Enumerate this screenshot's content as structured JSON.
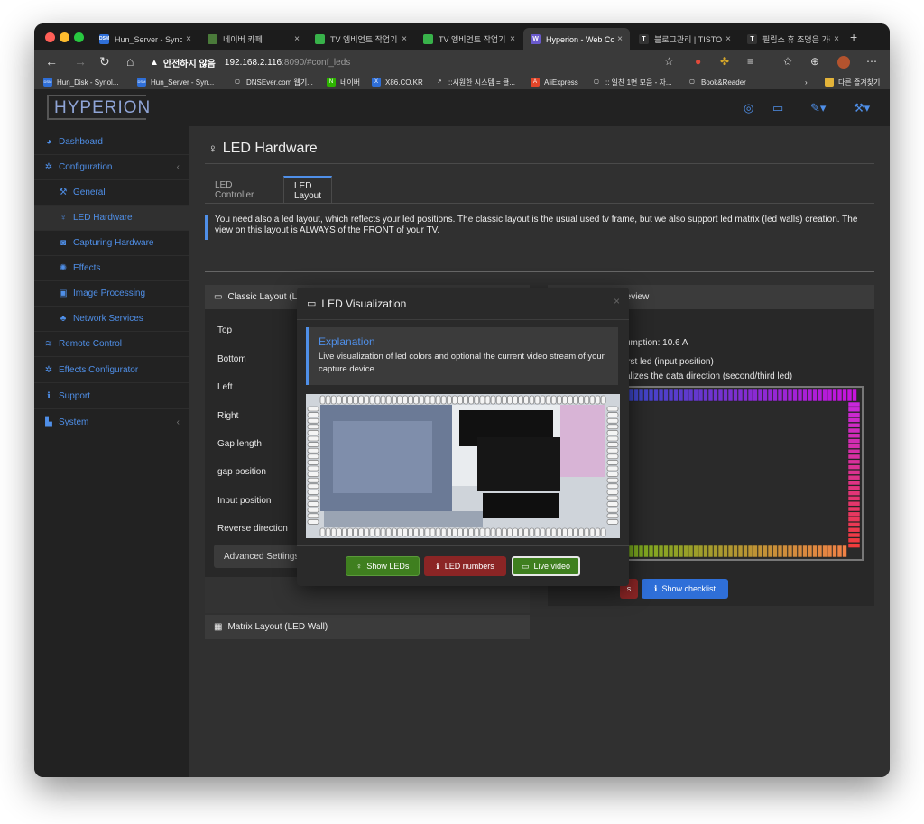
{
  "browser": {
    "tabs": [
      {
        "title": "Hun_Server - Synolo",
        "fav": "DSM",
        "color": "#2f6fd8"
      },
      {
        "title": "네이버 카페",
        "fav": "",
        "color": "#4a7a3a"
      },
      {
        "title": "TV 엠비언트 작업기 1/",
        "fav": "",
        "color": "#38b24a"
      },
      {
        "title": "TV 엠비언트 작업기 1/",
        "fav": "",
        "color": "#38b24a"
      },
      {
        "title": "Hyperion - Web Co",
        "fav": "W",
        "color": "#6a5acd"
      },
      {
        "title": "블로그관리 | TISTOR",
        "fav": "T",
        "color": "#333"
      },
      {
        "title": "필립스 휴 조명은 가리",
        "fav": "T",
        "color": "#333"
      }
    ],
    "close_glyph": "×",
    "newtab_glyph": "+",
    "url_warning": "안전하지 않음",
    "url_host": "192.168.2.116",
    "url_path": ":8090/#conf_leds",
    "bookmarks": [
      {
        "label": "Hun_Disk - Synol...",
        "fav": "DSM",
        "color": "#2f6fd8"
      },
      {
        "label": "Hun_Server - Syn...",
        "fav": "DSM",
        "color": "#2f6fd8"
      },
      {
        "label": "DNSEver.com 웹기...",
        "fav": "▢",
        "color": "#3a3a3a"
      },
      {
        "label": "네이버",
        "fav": "N",
        "color": "#2db400"
      },
      {
        "label": "X86.CO.KR",
        "fav": "X",
        "color": "#2f6fd8"
      },
      {
        "label": "::시원한 시스템 = 클...",
        "fav": "↗",
        "color": "#3a3a3a"
      },
      {
        "label": "AliExpress",
        "fav": "A",
        "color": "#e2462a"
      },
      {
        "label": ":: 일찬 1면 모음 - 자...",
        "fav": "▢",
        "color": "#3a3a3a"
      },
      {
        "label": "Book&Reader",
        "fav": "▢",
        "color": "#3a3a3a"
      }
    ],
    "other_bookmarks": "다른 즐겨찾기"
  },
  "app": {
    "logo": "HYPERION",
    "sidebar": [
      {
        "label": "Dashboard",
        "icon": "dashboard-icon",
        "glyph": "◕"
      },
      {
        "label": "Configuration",
        "icon": "gear-icon",
        "glyph": "✲"
      },
      {
        "label": "General",
        "icon": "wrench-icon",
        "glyph": "⚒"
      },
      {
        "label": "LED Hardware",
        "icon": "lightbulb-icon",
        "glyph": "♀"
      },
      {
        "label": "Capturing Hardware",
        "icon": "camera-icon",
        "glyph": "◙"
      },
      {
        "label": "Effects",
        "icon": "spinner-icon",
        "glyph": "✺"
      },
      {
        "label": "Image Processing",
        "icon": "image-icon",
        "glyph": "▣"
      },
      {
        "label": "Network Services",
        "icon": "sitemap-icon",
        "glyph": "♣"
      },
      {
        "label": "Remote Control",
        "icon": "wifi-icon",
        "glyph": "≋"
      },
      {
        "label": "Effects Configurator",
        "icon": "gears-icon",
        "glyph": "✲"
      },
      {
        "label": "Support",
        "icon": "info-icon",
        "glyph": "ℹ"
      },
      {
        "label": "System",
        "icon": "bar-chart-icon",
        "glyph": "▙"
      }
    ],
    "page_title": "LED Hardware",
    "tabs": [
      "LED Controller",
      "LED Layout"
    ],
    "info_text": "You need also a led layout, which reflects your led positions. The classic layout is the usual used tv frame, but we also support led matrix (led walls) creation. The view on this layout is ALWAYS of the FRONT of your TV.",
    "classic_panel": {
      "title": "Classic Layout (LED Frame)",
      "fields": [
        "Top",
        "Bottom",
        "Left",
        "Right",
        "Gap length",
        "gap position",
        "Input position",
        "Reverse direction"
      ],
      "advanced": "Advanced Settings"
    },
    "matrix_panel": {
      "title": "Matrix Layout (LED Wall)"
    },
    "preview_panel": {
      "title": "LED Layout Preview",
      "consumption": "umption: 10.6 A",
      "first_led": "irst led (input position)",
      "direction": "alizes the data direction (second/third led)",
      "checklist": "Show checklist"
    },
    "modal": {
      "title": "LED Visualization",
      "close": "×",
      "explain_title": "Explanation",
      "explain_body": "Live visualization of led colors and optional the current video stream of your capture device.",
      "buttons": {
        "show_leds": "Show LEDs",
        "led_numbers": "LED numbers",
        "live_video": "Live video"
      }
    }
  },
  "colors": {
    "accent": "#4f8fe8",
    "btn_green": "#3f7f1f",
    "btn_red": "#8b2525",
    "btn_blue": "#2f6fd8"
  }
}
